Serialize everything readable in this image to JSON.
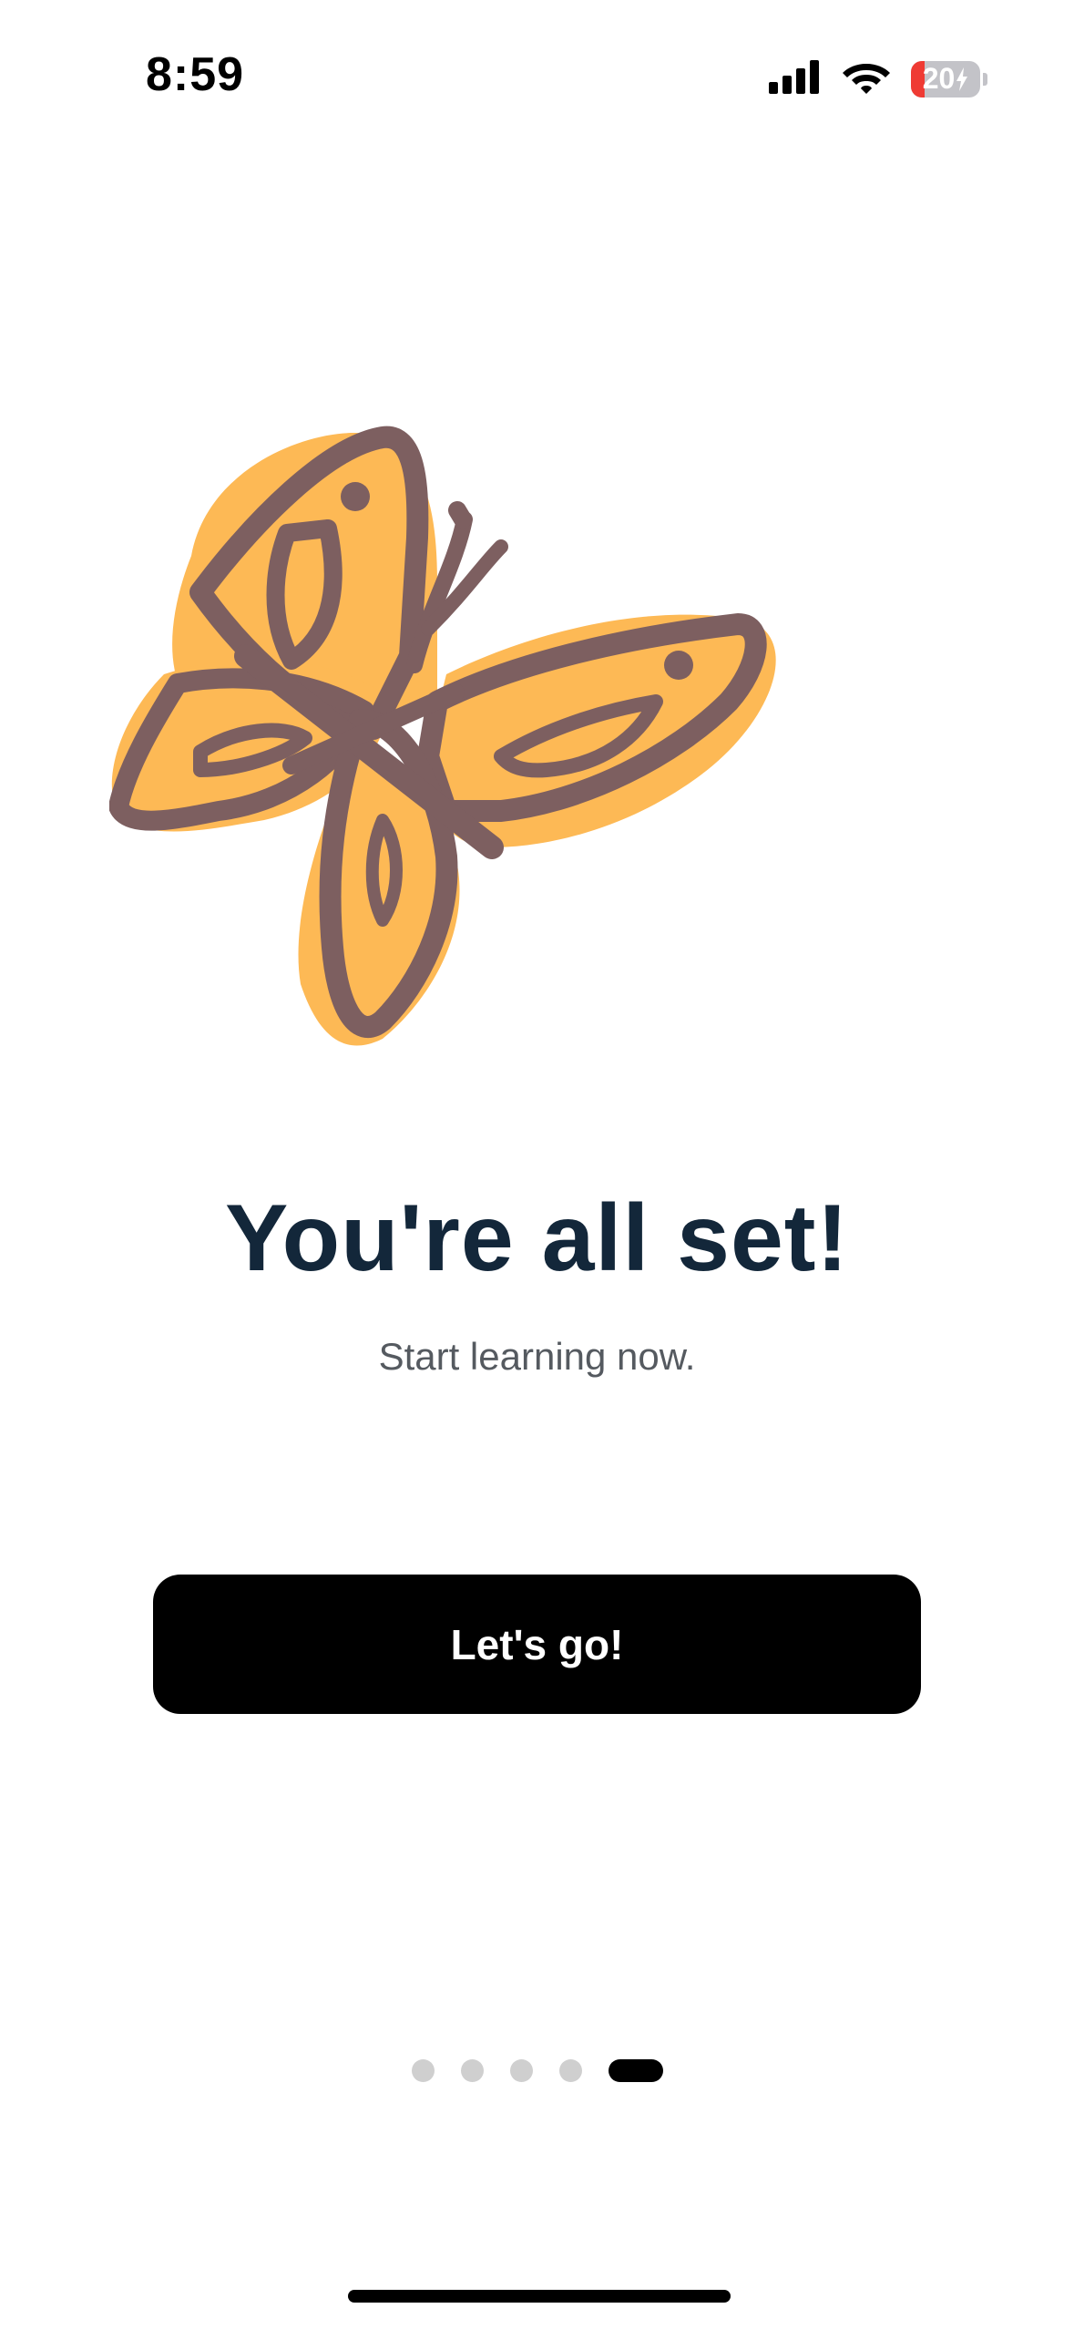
{
  "status_bar": {
    "time": "8:59",
    "battery_level": "20",
    "battery_fraction": 0.2,
    "icons": [
      "cellular-signal-icon",
      "wifi-icon",
      "battery-charging-icon"
    ]
  },
  "illustration": {
    "icon": "butterfly-illustration",
    "colors": {
      "wing_fill": "#FDB955",
      "outline": "#7D5F60"
    }
  },
  "main": {
    "title": "You're all set!",
    "subtitle": "Start learning now.",
    "cta_label": "Let's go!"
  },
  "pager": {
    "total_pages": 5,
    "current_page": 5
  },
  "colors": {
    "title": "#13273A",
    "subtitle": "#555A60",
    "button_bg": "#000000",
    "button_text": "#FFFFFF",
    "dot_inactive": "#CFCFCF",
    "dot_active": "#000000",
    "battery_low": "#EF3B34"
  }
}
